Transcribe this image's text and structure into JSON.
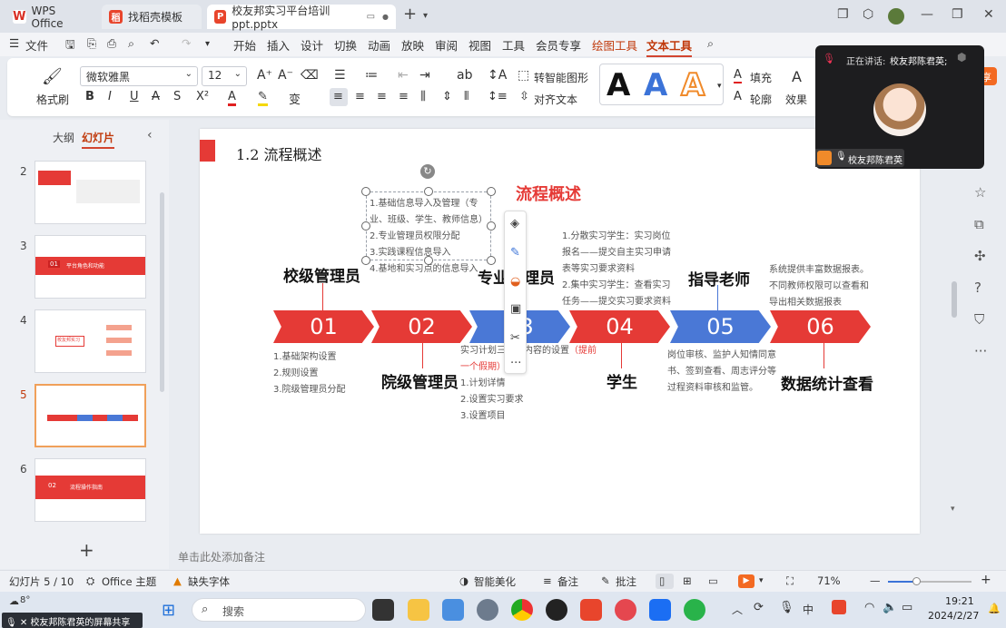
{
  "titlebar": {
    "tabs": [
      {
        "label": "WPS Office",
        "icon": "wps-logo-icon"
      },
      {
        "label": "找稻壳模板",
        "icon": "docer-icon"
      },
      {
        "label": "校友邦实习平台培训ppt.pptx",
        "icon": "ppt-icon"
      }
    ],
    "new_tab": "+"
  },
  "menubar": {
    "file": "文件",
    "items": [
      "开始",
      "插入",
      "设计",
      "切换",
      "动画",
      "放映",
      "审阅",
      "视图",
      "工具",
      "会员专享",
      "绘图工具",
      "文本工具"
    ],
    "share": "分享"
  },
  "ribbon": {
    "format_painter": "格式刷",
    "font_name": "微软雅黑",
    "font_size": "12",
    "smart_shape": "转智能图形",
    "align_text": "对齐文本",
    "fill": "填充",
    "outline": "轮廓",
    "effect": "效果",
    "style_letters": [
      "A",
      "A",
      "A"
    ]
  },
  "leftpanel": {
    "tabs": [
      "大纲",
      "幻灯片"
    ],
    "slide_numbers": [
      "2",
      "3",
      "4",
      "5",
      "6"
    ],
    "thumb_texts": {
      "t3_num": "01",
      "t3_title": "平台角色和功能",
      "t4_title": "校友邦实习",
      "t6_num": "02",
      "t6_title": "流程操作指南"
    },
    "add": "+"
  },
  "slide": {
    "section_title": "1.2  流程概述",
    "heading": "流程概述",
    "steps": [
      {
        "num": "01",
        "color": "#e53a36"
      },
      {
        "num": "02",
        "color": "#e53a36"
      },
      {
        "num": "03",
        "color": "#4a78d6"
      },
      {
        "num": "04",
        "color": "#e53a36"
      },
      {
        "num": "05",
        "color": "#4a78d6"
      },
      {
        "num": "06",
        "color": "#e53a36"
      }
    ],
    "roles": {
      "r1": "校级管理员",
      "r2": "院级管理员",
      "r3": "专业管理员",
      "r4": "学生",
      "r5": "指导老师",
      "r6": "数据统计查看"
    },
    "texts": {
      "school_below": "1.基础架构设置\n2.规则设置\n3.院级管理员分配",
      "college_above": "1.基础信息导入及管理（专\n业、班级、学生、教师信息）\n2.专业管理员权限分配\n3.实践课程信息导入\n4.基地和实习点的信息导入",
      "major_below_1": "实习计划三部分内容的设置",
      "major_below_red": "（提前\n一个假期）",
      "major_below_2": "1.计划详情\n2.设置实习要求\n3.设置项目",
      "student_above": "1.分散实习学生：实习岗位\n报名——提交自主实习申请\n表等实习要求资料\n2.集中实习学生：查看实习\n任务——提交实习要求资料",
      "teacher_below": "岗位审核、监护人知情同意\n书、签到查看、周志评分等\n过程资料审核和监管。",
      "data_above": "系统提供丰富数据报表。\n不同教师权限可以查看和\n导出相关数据报表"
    }
  },
  "notes": {
    "placeholder": "单击此处添加备注"
  },
  "statusbar": {
    "slide_info": "幻灯片 5 / 10",
    "theme": "Office 主题",
    "missing_font": "缺失字体",
    "smart_beautify": "智能美化",
    "notes": "备注",
    "comments": "批注",
    "zoom": "71%"
  },
  "taskbar": {
    "weather": "8°",
    "search": "搜索",
    "time": "19:21",
    "date": "2024/2/27",
    "share_notice": "校友邦陈君英的屏幕共享",
    "ime": "中"
  },
  "meeting": {
    "speaking_label": "正在讲话:",
    "speaker": "校友邦陈君英;",
    "name_tag": "校友邦陈君英"
  }
}
